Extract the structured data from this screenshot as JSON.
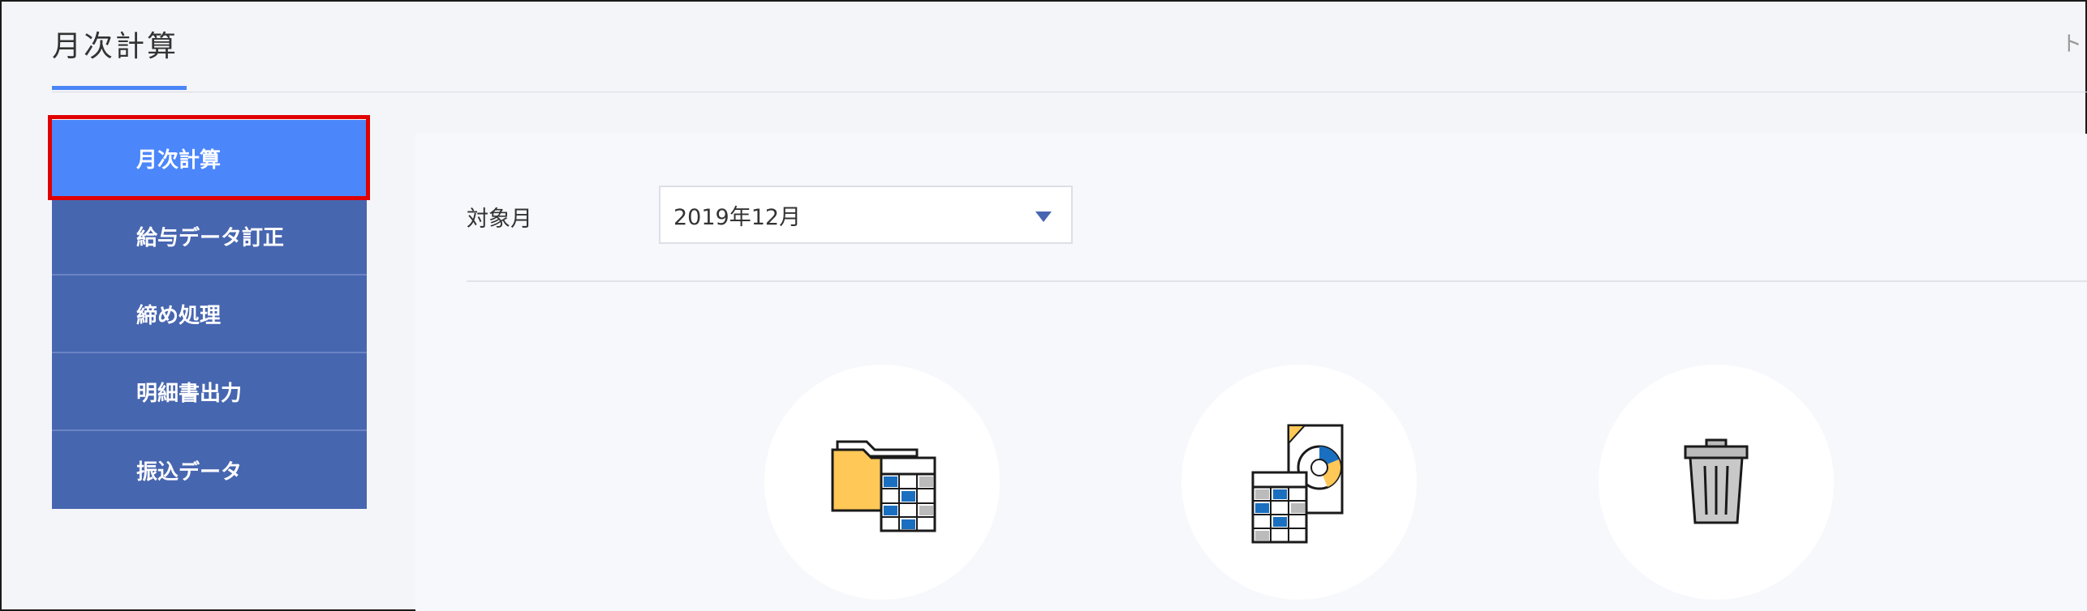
{
  "header": {
    "title": "月次計算",
    "right_text": "ト"
  },
  "sidebar": {
    "items": [
      {
        "label": "月次計算",
        "active": true
      },
      {
        "label": "給与データ訂正",
        "active": false
      },
      {
        "label": "締め処理",
        "active": false
      },
      {
        "label": "明細書出力",
        "active": false
      },
      {
        "label": "振込データ",
        "active": false
      }
    ]
  },
  "main": {
    "target_month_label": "対象月",
    "target_month_value": "2019年12月",
    "actions": [
      {
        "icon": "folder-spreadsheet-icon"
      },
      {
        "icon": "calculator-report-icon"
      },
      {
        "icon": "trash-icon"
      }
    ]
  },
  "colors": {
    "sidebar_bg": "#4766b0",
    "sidebar_active_bg": "#4b86fb",
    "highlight_outline": "#e00000",
    "title_underline": "#4a86f7",
    "folder_yellow": "#ffc857",
    "cell_blue": "#1a6fc0"
  }
}
